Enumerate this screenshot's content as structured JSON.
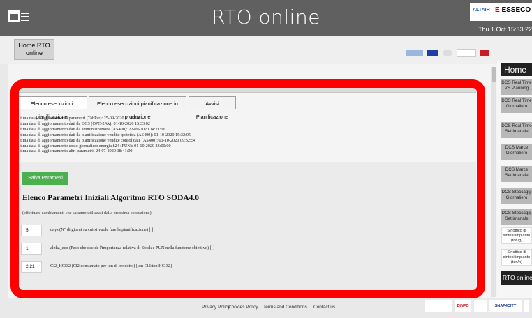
{
  "header": {
    "app_title": "RTO online",
    "logo_altair": "ALTAIR",
    "logo_esseco_prefix": "E",
    "logo_esseco": "ESSECO",
    "clock": "Thu 1 Oct 15:33:22"
  },
  "subheader": {
    "home_button": "Home RTO online"
  },
  "tabs": [
    {
      "label": "Elenco esecuzioni pianificazione"
    },
    {
      "label": "Elenco esecuzioni pianificazione in produzione"
    },
    {
      "label": "Avvisi Pianificazione"
    }
  ],
  "info_lines": [
    "Ultima data di aggiornamento parametri (TabPar): 25-09-2020 11:47:36",
    "Ultima data di aggiornamento dati da DCS (OPC-2Ak): 01-10-2020 15:33:02",
    "Ultima data di aggiornamento dati da amministrazione (AS400): 22-09-2020 14:21:06",
    "Ultima data di aggiornamento dati da pianificazione vendite ipotetica (AS400): 01-10-2020 15:32:05",
    "Ultima data di aggiornamento dati da pianificazione vendite consolidate (AS400): 01-10-2020 09:32:54",
    "Ultima data di aggiornamento costo giornaliero energia h24 (PUN): 01-10-2020 23:00:00",
    "Ultima data di aggiornamento altri parametri: 24-07-2020 18:41:00"
  ],
  "save_button": "Salva Parametri",
  "section_title": "Elenco Parametri Iniziali Algoritmo RTO SODA4.0",
  "section_note": "(effettuare cambiamenti che saranno utilizzati dalla prossima esecuzione)",
  "params": [
    {
      "value": "5",
      "label": "days (N° di giorni su cui si vuole fare la pianificazione) [ ]"
    },
    {
      "value": "1",
      "label": "alpha_eco (Peso che decide l'importanza relativa di Stock e PUN nella funzione obiettivo) [-]"
    },
    {
      "value": "2.21",
      "label": "Cl2_HCl32 (Cl2 consumato per ton di prodotto) [ton Cl2/ton HCl32]"
    }
  ],
  "sidebar": {
    "title": "Home",
    "items": [
      {
        "line1": "DCS Real Time",
        "line2": "VS Planning",
        "style": "gray"
      },
      {
        "line1": "DCS Real Time",
        "line2": "Giornaliero",
        "style": "gray"
      },
      {
        "line1": "DCS Real Time",
        "line2": "Settimanale",
        "style": "gray"
      },
      {
        "line1": "DCS Marce",
        "line2": "Giornaliero",
        "style": "gray"
      },
      {
        "line1": "DCS Marce",
        "line2": "Settimanale",
        "style": "gray"
      },
      {
        "line1": "DCS Stoccaggi",
        "line2": "Giornaliero",
        "style": "gray"
      },
      {
        "line1": "DCS Stoccaggi",
        "line2": "Settimanale",
        "style": "gray"
      },
      {
        "line1": "Sinottico di",
        "line2": "sintesi impianto",
        "line3": "(ton/g)",
        "style": "white"
      },
      {
        "line1": "Sinottico di",
        "line2": "sintesi impianto",
        "line3": "(ton/h)",
        "style": "white"
      }
    ],
    "footer_item": "RTO online"
  },
  "footer": {
    "links": [
      "Privacy Policy",
      "Cookies Policy",
      "Terms and Conditions",
      "Contact us"
    ],
    "logo_texts": [
      "DINFO",
      "SNAP4CITY"
    ]
  },
  "colors": {
    "topbar": "#606060",
    "highlight_frame": "#ff0000",
    "save_button": "#4caf50",
    "sidebar_dark": "#222222"
  }
}
